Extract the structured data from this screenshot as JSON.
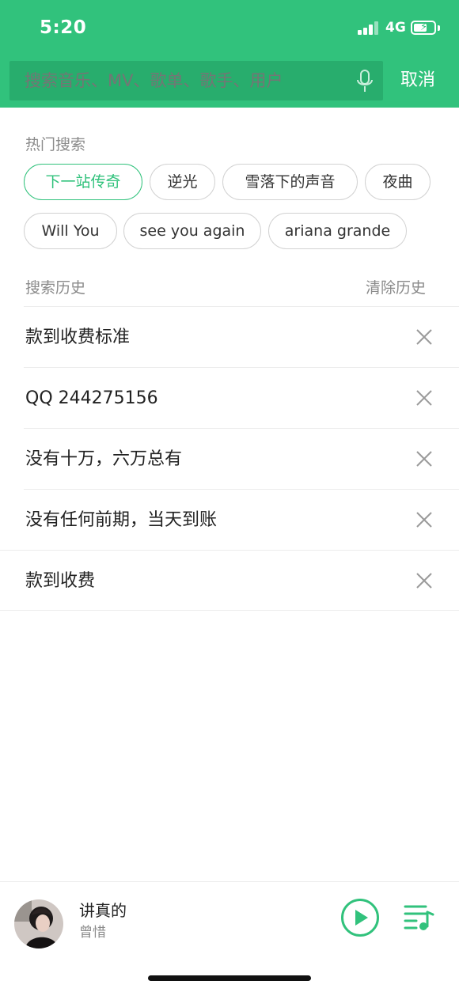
{
  "status_bar": {
    "time": "5:20",
    "network": "4G"
  },
  "search": {
    "placeholder": "搜索音乐、MV、歌单、歌手、用户",
    "cancel_label": "取消"
  },
  "hot_search": {
    "label": "热门搜索",
    "tags": [
      "下一站传奇",
      "逆光",
      "雪落下的声音",
      "夜曲",
      "Will You",
      "see you again",
      "ariana grande"
    ]
  },
  "history": {
    "label": "搜索历史",
    "clear_label": "清除历史",
    "items": [
      "款到收费标准",
      "QQ 244275156",
      "没有十万，六万总有",
      "没有任何前期，当天到账",
      "款到收费"
    ]
  },
  "player": {
    "song_title": "讲真的",
    "artist": "曾惜"
  },
  "colors": {
    "brand_green": "#31c27c",
    "search_box": "#28ad6d"
  },
  "icons": [
    "microphone-icon",
    "close-icon",
    "play-icon",
    "playlist-icon"
  ]
}
